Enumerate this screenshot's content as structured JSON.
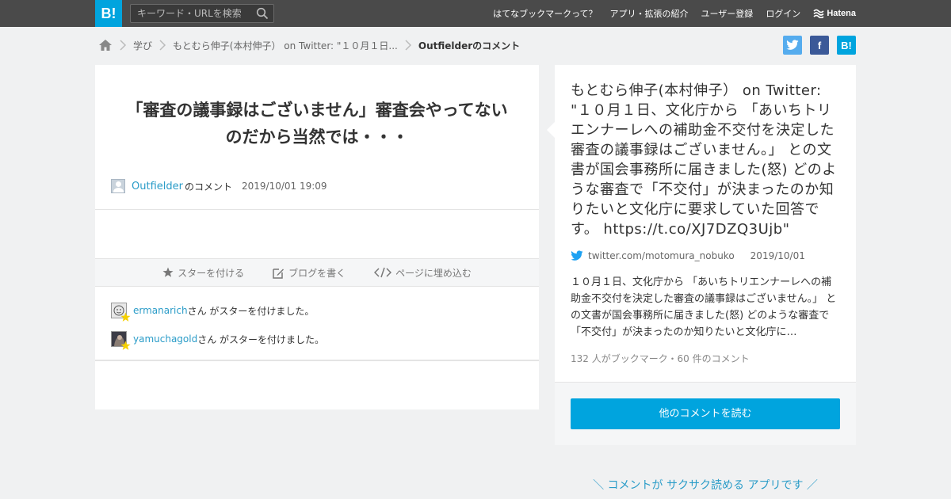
{
  "header": {
    "logo": "B!",
    "search_placeholder": "キーワード・URLを検索",
    "nav": [
      "はてなブックマークって？",
      "アプリ・拡張の紹介",
      "ユーザー登録",
      "ログイン"
    ],
    "brand": "Hatena"
  },
  "breadcrumb": {
    "items": [
      "学び",
      "もとむら伸子(本村伸子） on Twitter: \"１０月１日..."
    ],
    "current": "Outfielderのコメント"
  },
  "share": {
    "facebook": "f",
    "hatena": "B!"
  },
  "comment": {
    "text": "「審査の議事録はございません」審査会やってないのだから当然では・・・",
    "user": "Outfielder",
    "user_suffix": "のコメント",
    "date": "2019/10/01 19:09"
  },
  "actions": {
    "star": "スターを付ける",
    "blog": "ブログを書く",
    "embed": "ページに埋め込む"
  },
  "stars": [
    {
      "user": "ermanarich",
      "text": "さん がスターを付けました。"
    },
    {
      "user": "yamuchagold",
      "text": "さん がスターを付けました。"
    }
  ],
  "entry": {
    "title": "もとむら伸子(本村伸子） on Twitter: \"１０月１日、文化庁から 「あいちトリエンナーレへの補助金不交付を決定した審査の議事録はございません。」 との文書が国会事務所に届きました(怒) どのような審査で「不交付」が決まったのか知りたいと文化庁に要求していた回答です。 https://t.co/XJ7DZQ3Ujb\"",
    "domain": "twitter.com/motomura_nobuko",
    "date": "2019/10/01",
    "summary": "１０月１日、文化庁から 「あいちトリエンナーレへの補助金不交付を決定した審査の議事録はございません。」 との文書が国会事務所に届きました(怒) どのような審査で「不交付」が決まったのか知りたいと文化庁に…",
    "count": "132 人がブックマーク・60 件のコメント"
  },
  "more_button": "他のコメントを読む",
  "app_promo": "＼ コメントが サクサク読める アプリです ／",
  "colors": {
    "accent": "#00a4de",
    "link": "#2a9cc8",
    "topbar": "#4a4a4a",
    "background": "#f0f1f2"
  }
}
